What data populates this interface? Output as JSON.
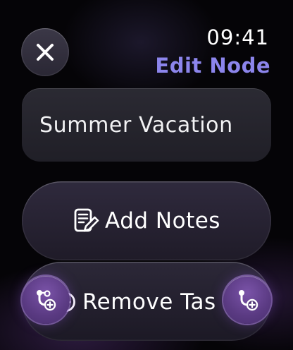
{
  "status_bar": {
    "time": "09:41"
  },
  "header": {
    "title": "Edit Node",
    "title_color": "#8c85ec"
  },
  "node": {
    "name": "Summer Vacation"
  },
  "actions": {
    "add_notes_label": "Add Notes",
    "remove_task_label": "Remove Tas"
  },
  "icons": {
    "close": "close-icon",
    "notes": "note-pencil-icon",
    "remove": "minus-circle-icon",
    "add_child_left": "add-branch-icon",
    "add_child_right": "add-branch-icon"
  },
  "colors": {
    "accent": "#8c85ec",
    "fab": "#5a3a82"
  }
}
